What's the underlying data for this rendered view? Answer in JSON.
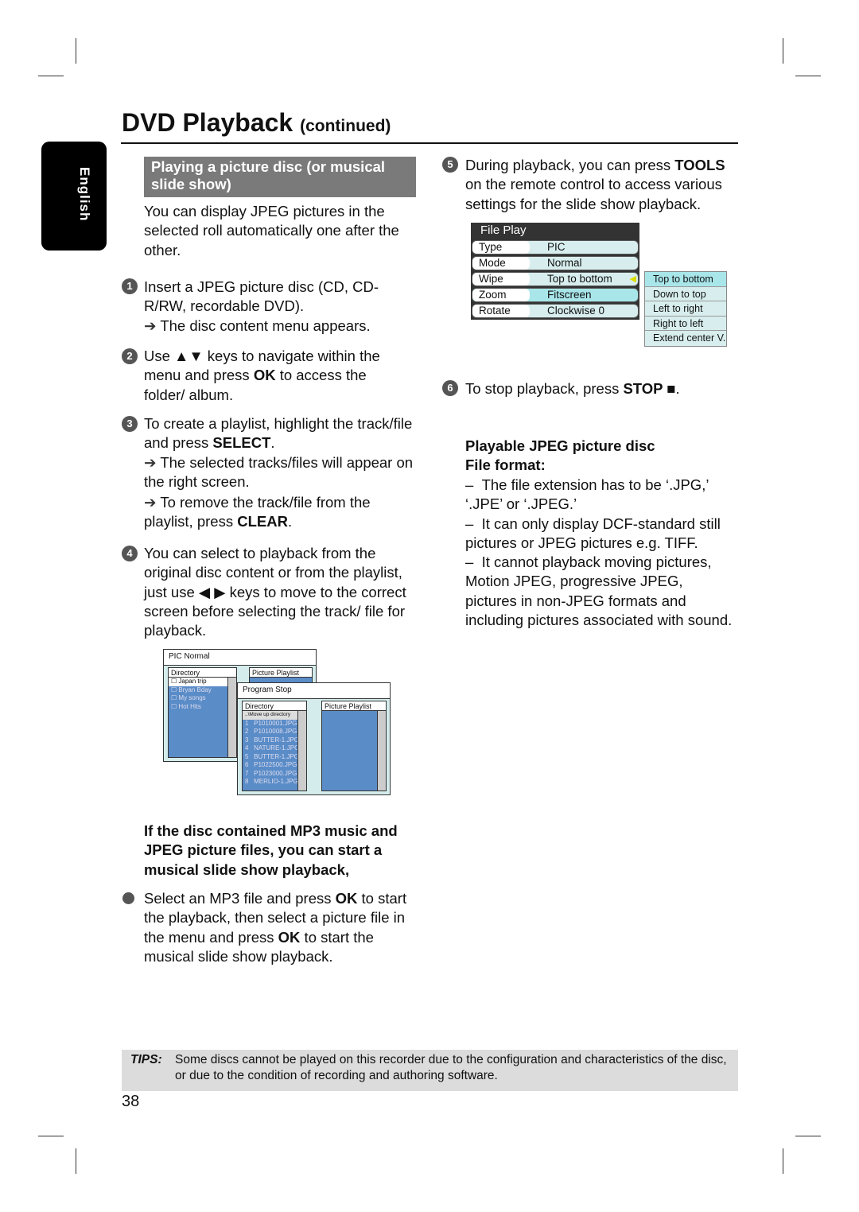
{
  "header": {
    "title": "DVD Playback",
    "subtitle": "(continued)"
  },
  "side_tab": "English",
  "section": {
    "heading": "Playing a picture disc (or musical slide show)",
    "intro": "You can display JPEG pictures in the selected roll automatically one after the other."
  },
  "steps": [
    {
      "n": "1",
      "text": "Insert a JPEG picture disc (CD, CD-R/RW, recordable DVD).",
      "result": "The disc content menu appears."
    },
    {
      "n": "2",
      "pre": "Use ▲▼ keys to navigate within the menu and press ",
      "key": "OK",
      "post": " to access the folder/ album."
    },
    {
      "n": "3",
      "pre": "To create a playlist, highlight the track/file and press ",
      "key": "SELECT",
      "post": ".",
      "r1": "The selected tracks/files will appear on the right screen.",
      "r2pre": "To remove the track/file from the playlist, press ",
      "r2key": "CLEAR",
      "r2post": "."
    },
    {
      "n": "4",
      "text": "You can select to playback from the original disc content or from the playlist, just use ◀ ▶ keys to move to the correct screen before selecting the track/ file for playback."
    },
    {
      "n": "5",
      "pre": "During playback, you can press ",
      "key": "TOOLS",
      "post": " on the remote control to access various settings for the slide show playback."
    },
    {
      "n": "6",
      "pre": "To stop playback, press ",
      "key": "STOP ■",
      "post": "."
    }
  ],
  "file_play": {
    "title": "File Play",
    "rows": [
      {
        "k": "Type",
        "v": "PIC"
      },
      {
        "k": "Mode",
        "v": "Normal"
      },
      {
        "k": "Wipe",
        "v": "Top to bottom"
      },
      {
        "k": "Zoom",
        "v": "Fitscreen"
      },
      {
        "k": "Rotate",
        "v": "Clockwise 0"
      }
    ],
    "options": [
      "Top to bottom",
      "Down to top",
      "Left to right",
      "Right to left",
      "Extend center V."
    ],
    "highlight_color": "#a8e6ea"
  },
  "screen1": {
    "title": "PIC Normal",
    "dir": "Directory",
    "playlist": "Picture Playlist",
    "items": [
      "Japan trip",
      "Bryan Bday",
      "My songs",
      "Hot Hits"
    ]
  },
  "screen2": {
    "title": "Program Stop",
    "dir": "Directory",
    "playlist": "Picture Playlist",
    "up": "..\\Move up directory",
    "files": [
      "P1010001.JPG",
      "P1010008.JPG",
      "BUTTER-1.JPG",
      "NATURE-1.JPG",
      "BUTTER-1.JPG",
      "P1022500.JPG",
      "P1023000.JPG",
      "MERLIO-1.JPG"
    ]
  },
  "mp3": {
    "heading": "If the disc contained MP3 music and JPEG picture files, you can start a musical slide show playback,",
    "p1": "Select an MP3 file and press ",
    "k1": "OK",
    "p2": " to start the playback, then select a picture file in the menu and press ",
    "k2": "OK",
    "p3": " to start the musical slide show playback."
  },
  "jpeg": {
    "heading1": "Playable JPEG picture disc",
    "heading2": "File format:",
    "items": [
      "The file extension has to be ‘.JPG,’ ‘.JPE’ or ‘.JPEG.’",
      "It can only display DCF-standard still pictures or JPEG pictures e.g. TIFF.",
      "It cannot playback moving pictures, Motion JPEG, progressive JPEG, pictures in non-JPEG formats and including pictures associated with sound."
    ]
  },
  "tips": {
    "label": "TIPS:",
    "text": "Some discs cannot be played on this recorder due to the configuration and characteristics of the disc, or due to the condition of recording and authoring software."
  },
  "page_number": "38"
}
